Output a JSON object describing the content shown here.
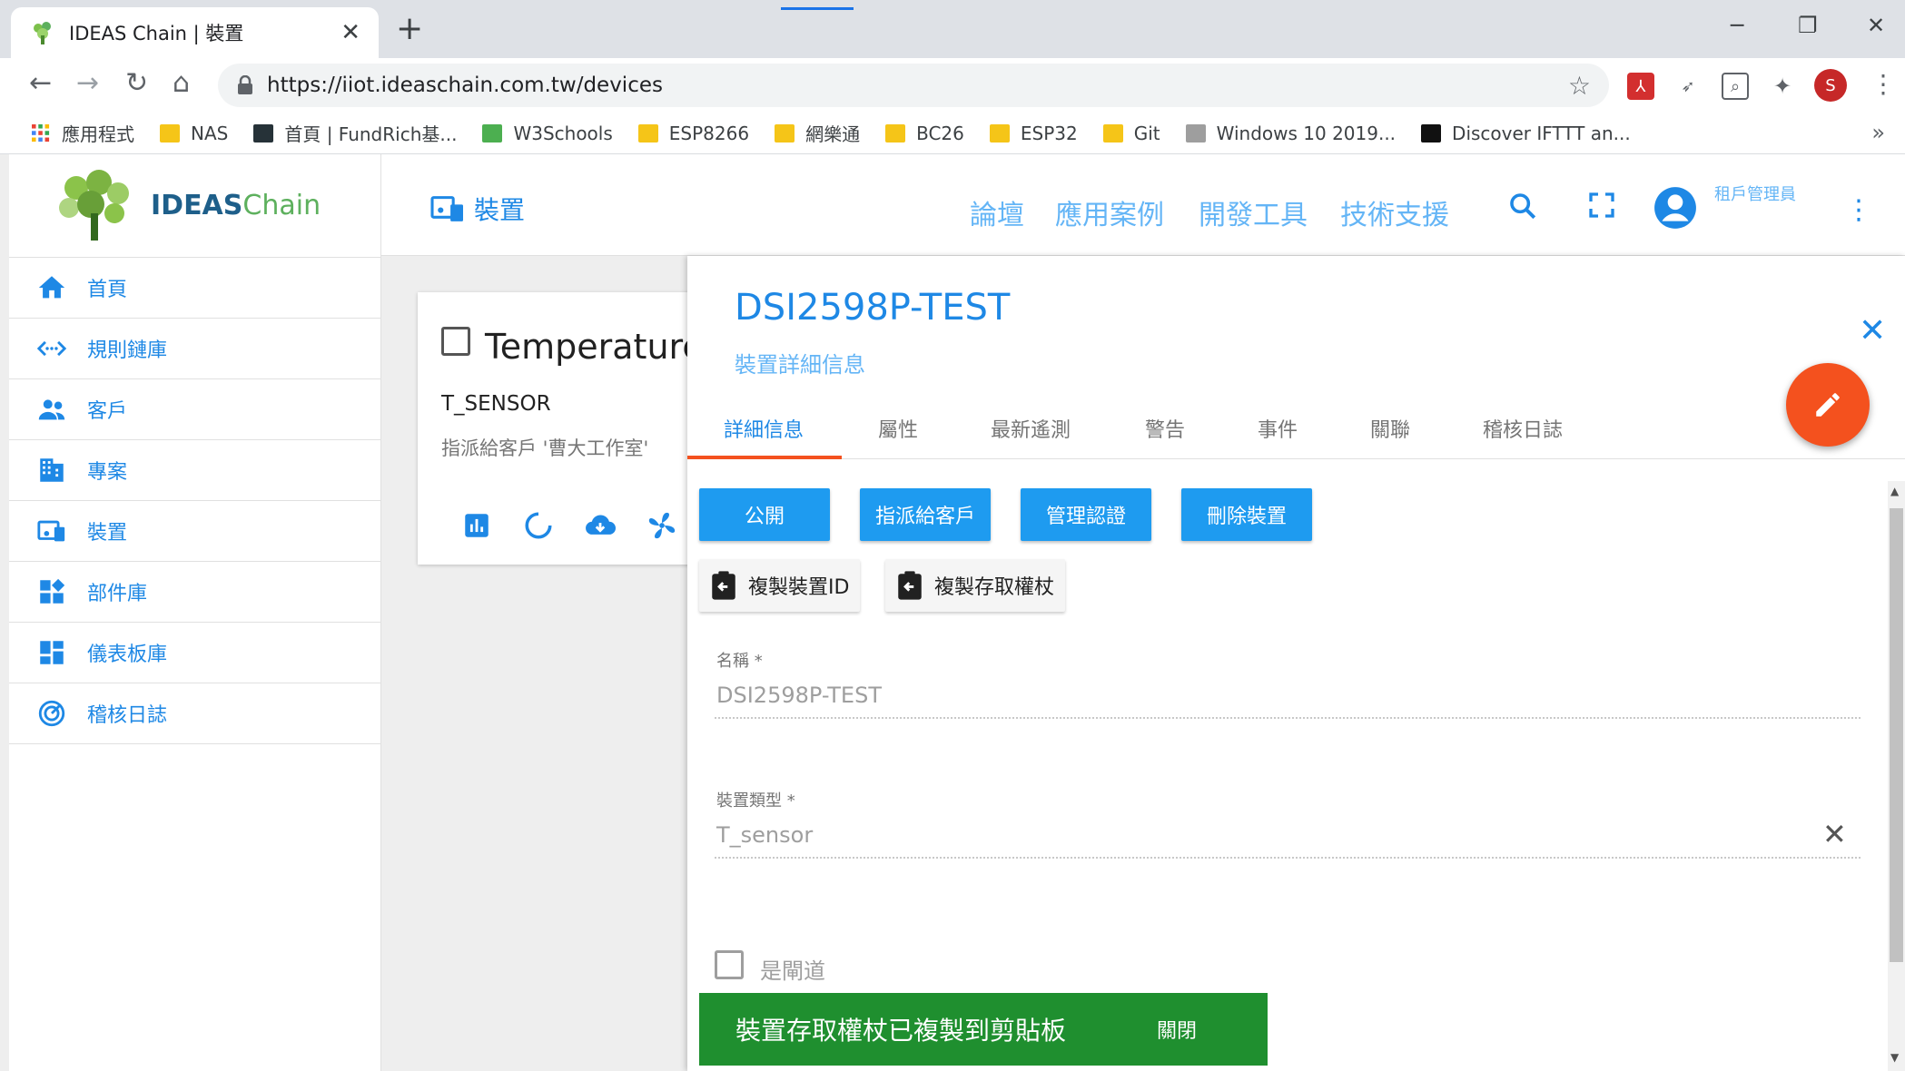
{
  "browser": {
    "tab_title": "IDEAS Chain | 裝置",
    "url": "https://iiot.ideaschain.com.tw/devices",
    "profile_initial": "S",
    "bookmarks": [
      "應用程式",
      "NAS",
      "首頁 | FundRich基...",
      "W3Schools",
      "ESP8266",
      "網樂通",
      "BC26",
      "ESP32",
      "Git",
      "Windows 10 2019...",
      "Discover IFTTT an..."
    ]
  },
  "app": {
    "logo": {
      "part1": "IDEAS",
      "part2": "Chain"
    },
    "sidebar": {
      "items": [
        {
          "label": "首頁",
          "icon": "home-icon"
        },
        {
          "label": "規則鏈庫",
          "icon": "code-arrows-icon"
        },
        {
          "label": "客戶",
          "icon": "people-icon"
        },
        {
          "label": "專案",
          "icon": "building-icon"
        },
        {
          "label": "裝置",
          "icon": "devices-icon"
        },
        {
          "label": "部件庫",
          "icon": "widgets-icon"
        },
        {
          "label": "儀表板庫",
          "icon": "dashboard-icon"
        },
        {
          "label": "稽核日誌",
          "icon": "track-changes-icon"
        }
      ]
    },
    "header": {
      "title": "裝置",
      "links": [
        "論壇",
        "應用案例",
        "開發工具",
        "技術支援"
      ],
      "user_role": "租戶管理員"
    },
    "card": {
      "name": "Temperature",
      "type": "T_SENSOR",
      "assigned": "指派給客戶 '曹大工作室'"
    },
    "details": {
      "title": "DSI2598P-TEST",
      "subtitle": "裝置詳細信息",
      "tabs": [
        "詳細信息",
        "屬性",
        "最新遙測",
        "警告",
        "事件",
        "關聯",
        "稽核日誌"
      ],
      "active_tab": "詳細信息",
      "buttons": {
        "public": "公開",
        "assign": "指派給客戶",
        "credentials": "管理認證",
        "delete": "刪除裝置"
      },
      "copy_buttons": {
        "copy_id": "複製裝置ID",
        "copy_token": "複製存取權杖"
      },
      "fields": {
        "name_label": "名稱 *",
        "name_value": "DSI2598P-TEST",
        "type_label": "裝置類型 *",
        "type_value": "T_sensor",
        "gateway_label": "是閘道"
      }
    },
    "snackbar": {
      "message": "裝置存取權杖已複製到剪貼板",
      "close_label": "關閉"
    }
  },
  "colors": {
    "primary": "#1e88e5",
    "accent": "#f4511e",
    "snackbar": "#1f8f2f",
    "button": "#1e9bf0"
  }
}
